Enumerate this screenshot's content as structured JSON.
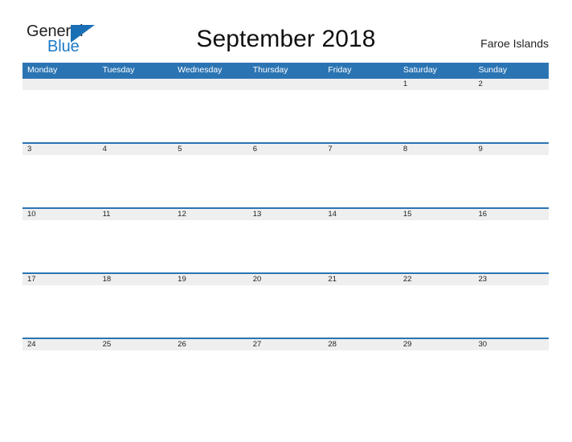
{
  "brand": {
    "name_part1": "General",
    "name_part2": "Blue",
    "logo_icon": "blue-triangle-flag-icon",
    "accent_color": "#1b7ac8"
  },
  "header": {
    "title": "September 2018",
    "region": "Faroe Islands"
  },
  "colors": {
    "header_blue": "#2b74b3",
    "band_gray": "#efeff0",
    "text_dark": "#231f20",
    "logo_blue": "#1b7ac8"
  },
  "calendar": {
    "month": "September",
    "year": "2018",
    "weekday_headers": [
      "Monday",
      "Tuesday",
      "Wednesday",
      "Thursday",
      "Friday",
      "Saturday",
      "Sunday"
    ],
    "weeks": [
      {
        "days": [
          "",
          "",
          "",
          "",
          "",
          "1",
          "2"
        ]
      },
      {
        "days": [
          "3",
          "4",
          "5",
          "6",
          "7",
          "8",
          "9"
        ]
      },
      {
        "days": [
          "10",
          "11",
          "12",
          "13",
          "14",
          "15",
          "16"
        ]
      },
      {
        "days": [
          "17",
          "18",
          "19",
          "20",
          "21",
          "22",
          "23"
        ]
      },
      {
        "days": [
          "24",
          "25",
          "26",
          "27",
          "28",
          "29",
          "30"
        ]
      }
    ]
  }
}
